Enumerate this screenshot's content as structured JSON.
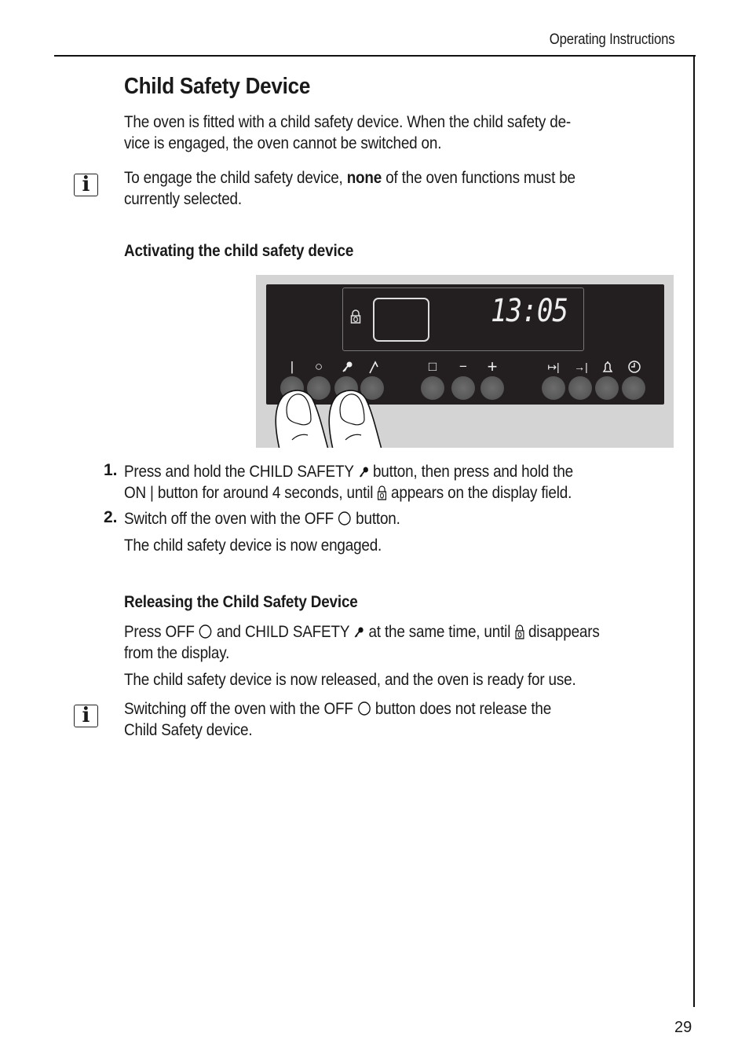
{
  "header": {
    "section": "Operating Instructions",
    "page_number": "29"
  },
  "title": "Child Safety Device",
  "intro": {
    "line1": "The oven is fitted with a child safety device. When the child safety de-",
    "line2": "vice is engaged, the oven cannot be switched on."
  },
  "note1": {
    "icon": "info-icon",
    "pre": "To engage the child safety device, ",
    "bold": "none",
    "post": " of the oven functions must be",
    "line2": "currently selected."
  },
  "activating": {
    "heading": "Activating the child safety device",
    "figure": {
      "display_time": "13:05",
      "display_icon": "lock-icon",
      "buttons": [
        {
          "name": "on",
          "symbol": "|"
        },
        {
          "name": "off",
          "symbol": "○"
        },
        {
          "name": "child-safety",
          "symbol": "key"
        },
        {
          "name": "function",
          "symbol": "/"
        },
        {
          "name": "square",
          "symbol": "□"
        },
        {
          "name": "minus",
          "symbol": "−"
        },
        {
          "name": "plus",
          "symbol": "+"
        },
        {
          "name": "duration",
          "symbol": "↦|"
        },
        {
          "name": "end-time",
          "symbol": "→|"
        },
        {
          "name": "timer",
          "symbol": "bell"
        },
        {
          "name": "clock",
          "symbol": "clock"
        }
      ]
    },
    "steps": [
      {
        "number": "1.",
        "l1a": "Press and hold the CHILD SAFETY ",
        "l1b": " button, then press and hold the",
        "l2a": "ON | button for around 4 seconds, until ",
        "l2b": " appears on the display field."
      },
      {
        "number": "2.",
        "l1a": "Switch off the oven with the OFF ",
        "l1b": " button."
      }
    ],
    "result": "The child safety device is now engaged."
  },
  "releasing": {
    "heading": "Releasing the Child Safety Device",
    "p1a": "Press OFF ",
    "p1b": " and CHILD SAFETY ",
    "p1c": " at the same time, until ",
    "p1d": " disappears",
    "p1line2": "from the display.",
    "p2": "The child safety device is now released, and the oven is ready for use."
  },
  "note2": {
    "icon": "info-icon",
    "l1a": "Switching off the oven with the OFF ",
    "l1b": " button does not release the",
    "line2": "Child Safety device."
  }
}
